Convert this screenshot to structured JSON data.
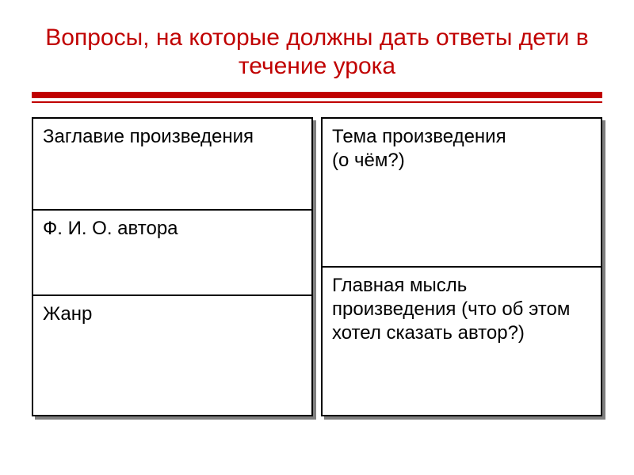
{
  "title": "Вопросы, на которые должны дать ответы дети в течение урока",
  "left": {
    "c1": "Заглавие произведения",
    "c2": "Ф. И. О. автора",
    "c3": "Жанр"
  },
  "right": {
    "c1_line1": "Тема произведения",
    "c1_line2": "(о чём?)",
    "c2": "Главная мысль произведения (что об этом хотел сказать автор?)"
  }
}
